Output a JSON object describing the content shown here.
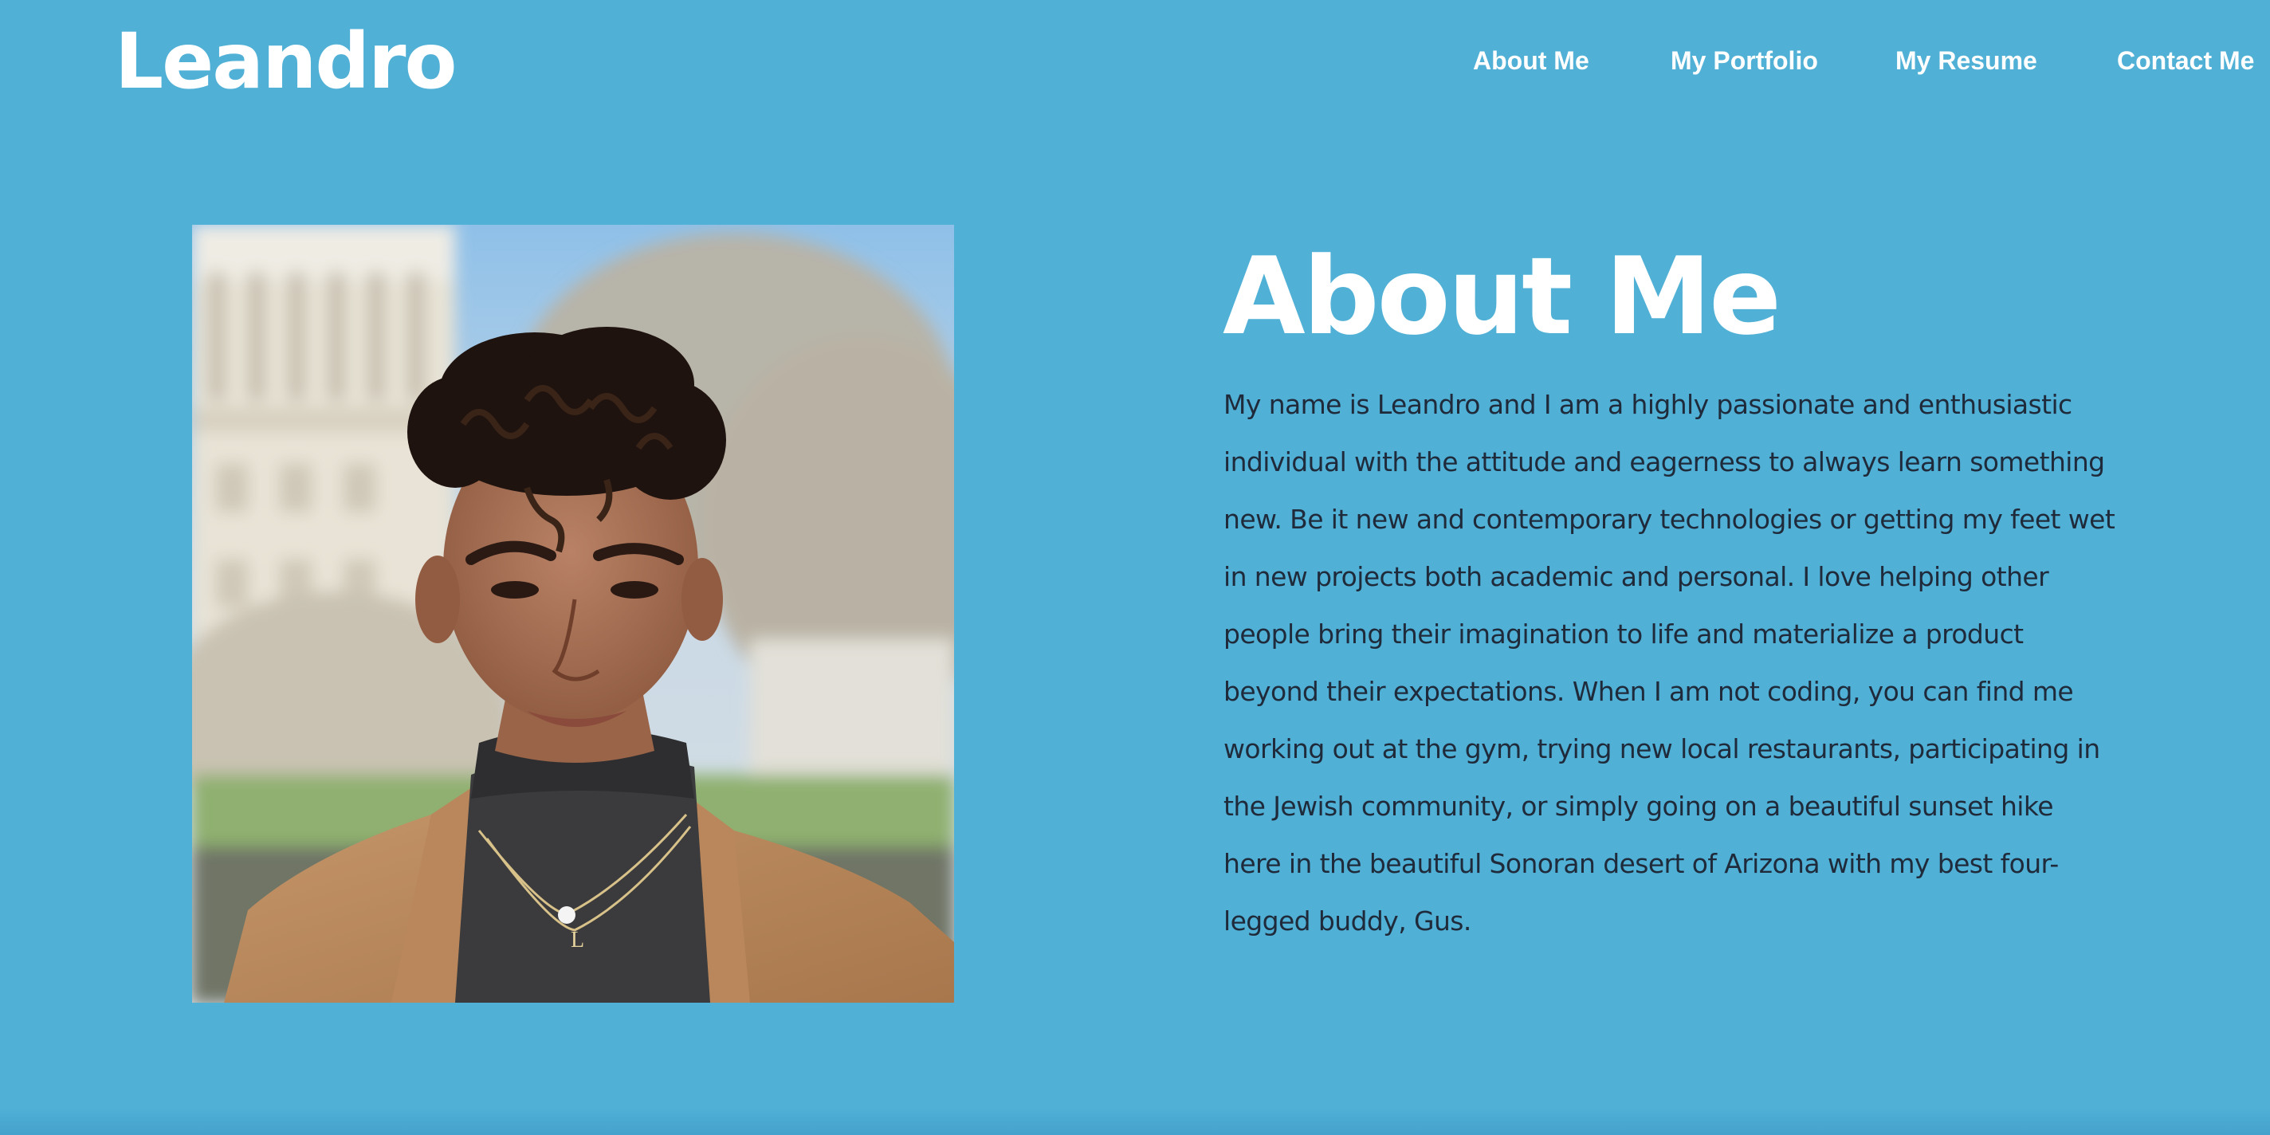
{
  "site": {
    "brand": "Leandro"
  },
  "nav": {
    "items": [
      {
        "label": "About Me"
      },
      {
        "label": "My Portfolio"
      },
      {
        "label": "My Resume"
      },
      {
        "label": "Contact Me"
      }
    ]
  },
  "about": {
    "heading": "About Me",
    "body": "My name is Leandro and I am a highly passionate and enthusiastic individual with the attitude and eagerness to always learn something new. Be it new and contemporary technologies or getting my feet wet in new projects both academic and personal. I love helping other people bring their imagination to life and materialize a product beyond their expectations. When I am not coding, you can find me working out at the gym, trying new local restaurants, participating in the Jewish community, or simply going on a beautiful sunset hike here in the beautiful Sonoran desert of Arizona with my best four-legged buddy, Gus."
  },
  "colors": {
    "background": "#50b0d6",
    "text_light": "#ffffff",
    "text_dark": "#1f2a3a"
  }
}
